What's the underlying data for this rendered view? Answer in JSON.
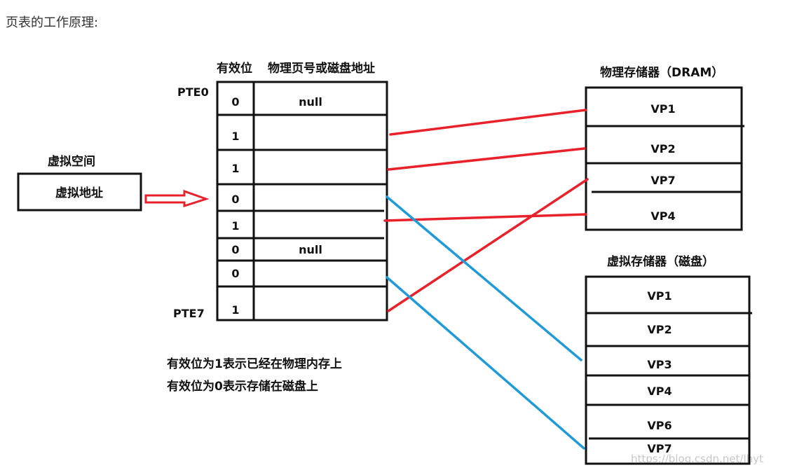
{
  "page_heading": "页表的工作原理:",
  "colors": {
    "mapped_dram": "#e8212b",
    "mapped_disk": "#1e9bd8",
    "outline": "#111111"
  },
  "virtual_space": {
    "title": "虚拟空间",
    "box_label": "虚拟地址"
  },
  "page_table": {
    "col_valid": "有效位",
    "col_addr": "物理页号或磁盘地址",
    "first_label": "PTE0",
    "last_label": "PTE7",
    "rows": [
      {
        "valid": "0",
        "addr": "null"
      },
      {
        "valid": "1",
        "addr": ""
      },
      {
        "valid": "1",
        "addr": ""
      },
      {
        "valid": "0",
        "addr": ""
      },
      {
        "valid": "1",
        "addr": ""
      },
      {
        "valid": "0",
        "addr": "null"
      },
      {
        "valid": "0",
        "addr": ""
      },
      {
        "valid": "1",
        "addr": ""
      }
    ]
  },
  "dram": {
    "title": "物理存储器（DRAM）",
    "pages": [
      "VP1",
      "VP2",
      "VP7",
      "VP4"
    ]
  },
  "disk": {
    "title": "虚拟存储器（磁盘）",
    "pages": [
      "VP1",
      "VP2",
      "VP3",
      "VP4",
      "VP6",
      "VP7"
    ]
  },
  "notes": [
    "有效位为1表示已经在物理内存上",
    "有效位为0表示存储在磁盘上"
  ],
  "mappings": [
    {
      "from_row": 1,
      "to": "dram",
      "to_index": 0
    },
    {
      "from_row": 2,
      "to": "dram",
      "to_index": 1
    },
    {
      "from_row": 4,
      "to": "dram",
      "to_index": 3
    },
    {
      "from_row": 7,
      "to": "dram",
      "to_index": 2
    },
    {
      "from_row": 3,
      "to": "disk",
      "to_index": 2
    },
    {
      "from_row": 6,
      "to": "disk",
      "to_index": 5
    }
  ],
  "watermark": "https://blog.csdn.net/lhyt"
}
